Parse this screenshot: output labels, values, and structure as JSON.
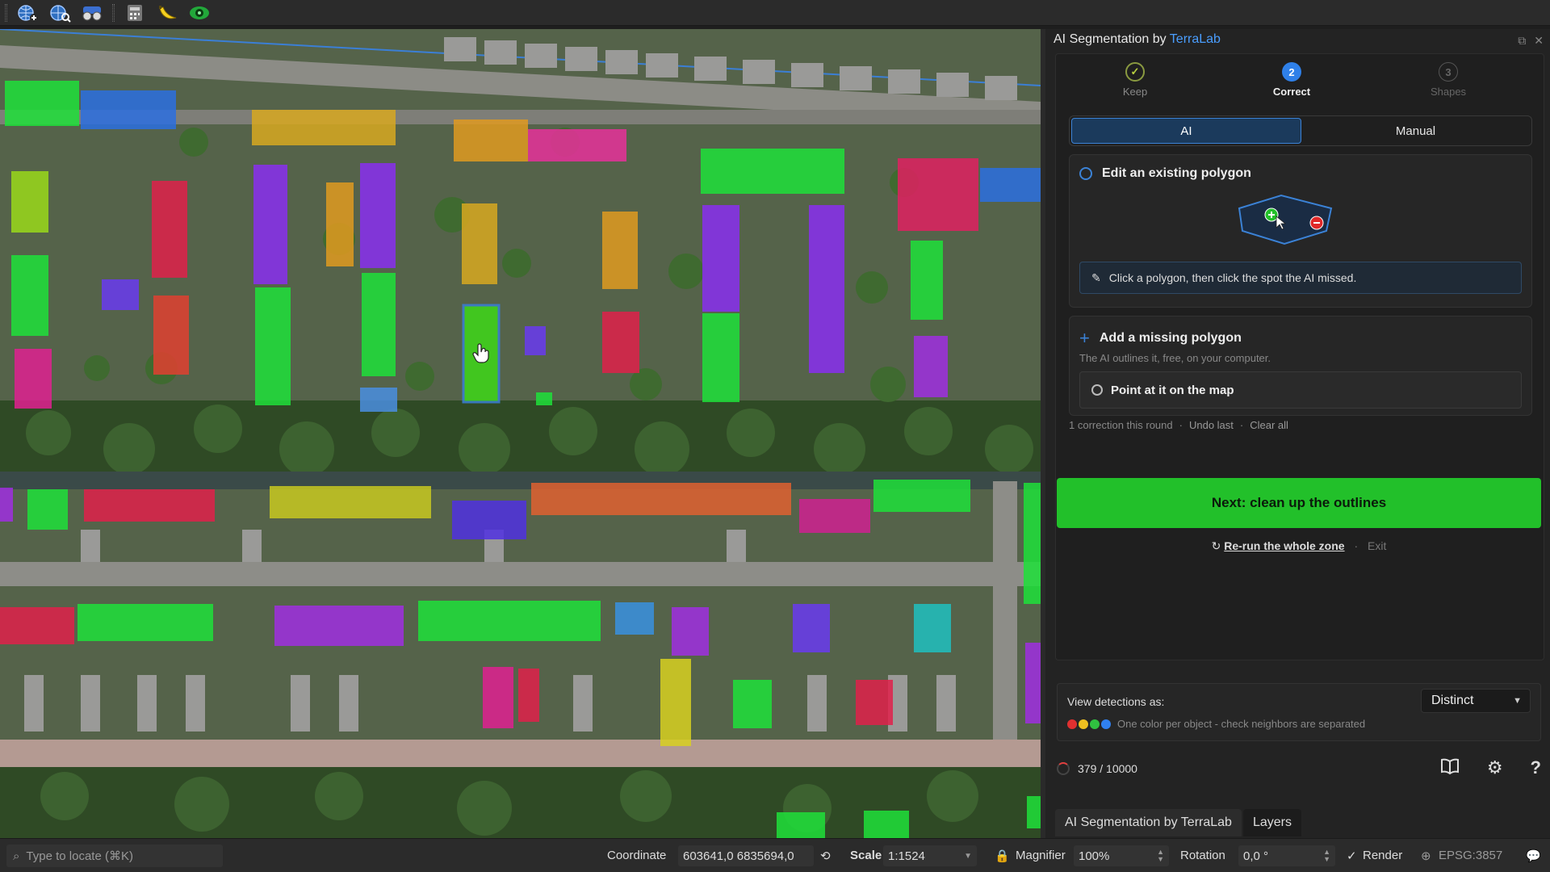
{
  "toolbar": {
    "icons": [
      "globe-add-icon",
      "globe-search-icon",
      "binoculars-icon",
      "calculator-icon",
      "banana-icon",
      "eye-icon"
    ]
  },
  "panel": {
    "title": "AI Segmentation by ",
    "brand": "TerraLab",
    "steps": [
      {
        "number": "✓",
        "label": "Keep",
        "state": "done"
      },
      {
        "number": "2",
        "label": "Correct",
        "state": "active"
      },
      {
        "number": "3",
        "label": "Shapes",
        "state": "pending"
      }
    ],
    "tabs": {
      "ai": "AI",
      "manual": "Manual"
    },
    "edit_card": {
      "title": "Edit an existing polygon",
      "hint": "Click a polygon, then click the spot the AI missed."
    },
    "add_card": {
      "title": "Add a missing polygon",
      "subtitle": "The AI outlines it, free, on your computer.",
      "button": "Point at it on the map"
    },
    "corrections": {
      "text": "1 correction this round",
      "undo": "Undo last",
      "clear": "Clear all"
    },
    "next_button": "Next: clean up the outlines",
    "rerun": "Re-run the whole zone",
    "exit": "Exit",
    "view": {
      "label": "View detections as:",
      "mode": "Distinct",
      "description": "One color per object - check neighbors are separated",
      "dot_colors": [
        "#e03030",
        "#f0c020",
        "#30c040",
        "#3080f0"
      ]
    },
    "counter": "379 / 10000",
    "bottom_tabs": [
      "AI Segmentation by TerraLab",
      "Layers"
    ]
  },
  "statusbar": {
    "locate_placeholder": "Type to locate (⌘K)",
    "coordinate_label": "Coordinate",
    "coordinate_value": "603641,0  6835694,0",
    "scale_label": "Scale",
    "scale_value": "1:1524",
    "magnifier_label": "Magnifier",
    "magnifier_value": "100%",
    "rotation_label": "Rotation",
    "rotation_value": "0,0 °",
    "render_label": "Render",
    "epsg": "EPSG:3857"
  },
  "colors": {
    "accent_blue": "#3b82d6",
    "brand_blue": "#4a9eff",
    "next_green": "#22c02a"
  }
}
